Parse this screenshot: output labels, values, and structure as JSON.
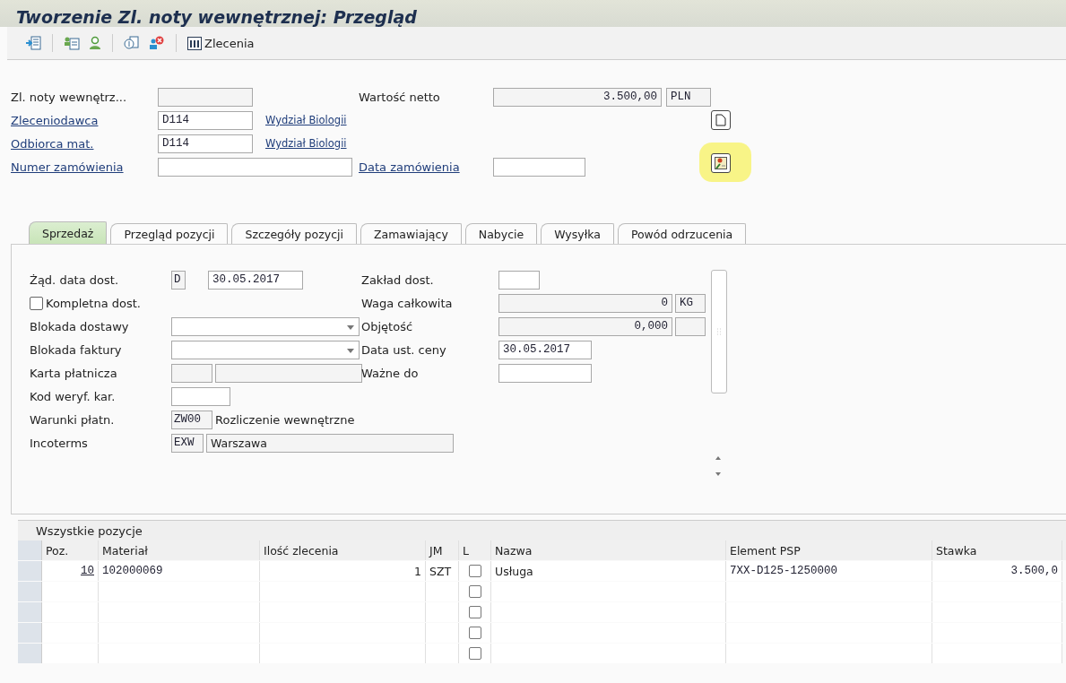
{
  "window": {
    "title": "Tworzenie Zl. noty wewnętrznej: Przegląd"
  },
  "toolbar": {
    "button_label": "Zlecenia"
  },
  "header": {
    "note": {
      "label": "Zl. noty wewnętrz..."
    },
    "net_value": {
      "label": "Wartość netto",
      "value": "3.500,00",
      "currency": "PLN"
    },
    "sold_to": {
      "label": "Zleceniodawca",
      "code": "D114",
      "name": "Wydział Biologii"
    },
    "ship_to": {
      "label": "Odbiorca mat.",
      "code": "D114",
      "name": "Wydział Biologii"
    },
    "po_number": {
      "label": "Numer zamówienia"
    },
    "po_date": {
      "label": "Data zamówienia"
    }
  },
  "tabs": [
    {
      "label": "Sprzedaż",
      "selected": true
    },
    {
      "label": "Przegląd pozycji",
      "selected": false
    },
    {
      "label": "Szczegóły pozycji",
      "selected": false
    },
    {
      "label": "Zamawiający",
      "selected": false
    },
    {
      "label": "Nabycie",
      "selected": false
    },
    {
      "label": "Wysyłka",
      "selected": false
    },
    {
      "label": "Powód odrzucenia",
      "selected": false
    }
  ],
  "sales_left": [
    {
      "kind": "date",
      "label": "Żąd. data dost.",
      "code": "D",
      "value": "30.05.2017"
    },
    {
      "kind": "checkbox",
      "label": "Kompletna dost.",
      "checked": false
    },
    {
      "kind": "dropdown",
      "label": "Blokada dostawy"
    },
    {
      "kind": "dropdown",
      "label": "Blokada faktury"
    },
    {
      "kind": "pair",
      "label": "Karta płatnicza"
    },
    {
      "kind": "field",
      "label": "Kod weryf. kar."
    },
    {
      "kind": "code-text",
      "label": "Warunki płatn.",
      "code": "ZW00",
      "text": "Rozliczenie wewnętrzne"
    },
    {
      "kind": "code-field",
      "label": "Incoterms",
      "code": "EXW",
      "value": "Warszawa"
    }
  ],
  "sales_right": [
    {
      "kind": "short",
      "label": "Zakład dost."
    },
    {
      "kind": "unit",
      "label": "Waga całkowita",
      "value": "0",
      "unit": "KG"
    },
    {
      "kind": "unit",
      "label": "Objętość",
      "value": "0,000"
    },
    {
      "kind": "field",
      "label": "Data ust. ceny",
      "value": "30.05.2017"
    },
    {
      "kind": "field",
      "label": "Ważne do"
    }
  ],
  "table": {
    "title": "Wszystkie pozycje",
    "columns": [
      "Poz.",
      "Materiał",
      "Ilość zlecenia",
      "JM",
      "L",
      "Nazwa",
      "Element PSP",
      "Stawka"
    ],
    "rows": [
      {
        "cells": [
          "10",
          "102000069",
          "1",
          "SZT",
          "Usługa",
          "7XX-D125-1250000",
          "3.500,0"
        ],
        "checked": false
      },
      {
        "checked": false
      },
      {
        "checked": false
      },
      {
        "checked": false
      },
      {
        "checked": false
      }
    ]
  }
}
